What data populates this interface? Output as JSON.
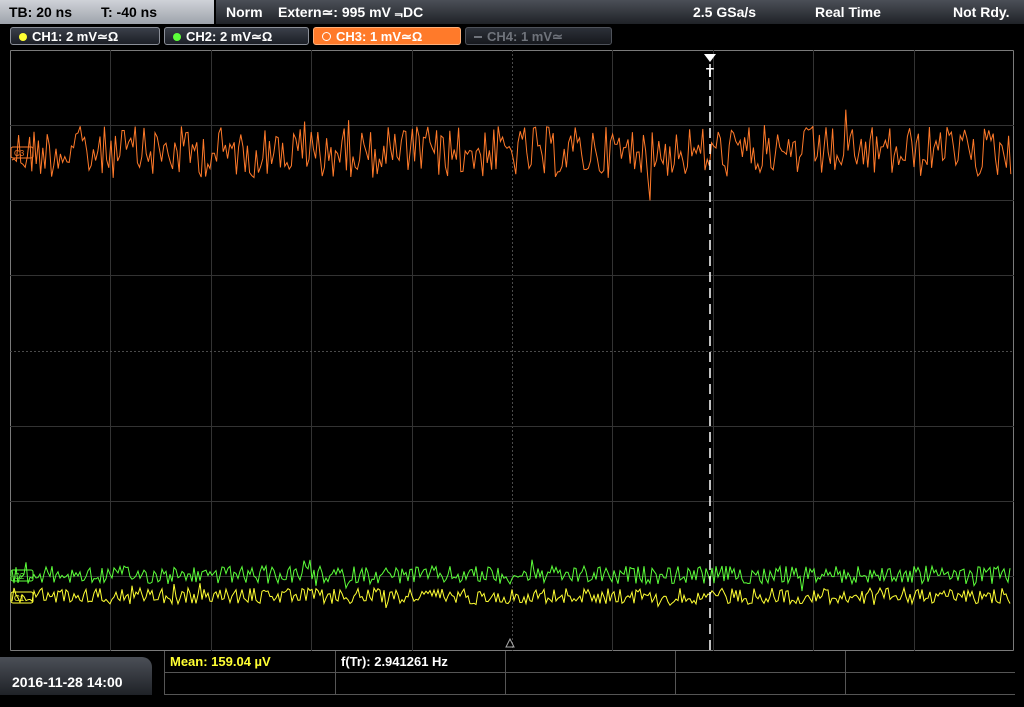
{
  "topbar": {
    "timebase": "TB: 20 ns",
    "trigger_time": "T: -40 ns",
    "acq_mode": "Norm",
    "trigger_source": "Extern≃: 995 mV ⫬DC",
    "sample_rate": "2.5 GSa/s",
    "timing_mode": "Real Time",
    "status": "Not Rdy."
  },
  "channels": [
    {
      "label": "CH1: 2 mV≃Ω",
      "color": "#ffff33",
      "state": "on"
    },
    {
      "label": "CH2: 2 mV≃Ω",
      "color": "#5cff3a",
      "state": "on"
    },
    {
      "label": "CH3: 1 mV≃Ω",
      "color": "#ff7a2a",
      "state": "active"
    },
    {
      "label": "CH4: 1 mV≃",
      "color": "#6f737b",
      "state": "off"
    }
  ],
  "screen": {
    "trigger_marker": "T",
    "ch_markers": {
      "ch1": "C1",
      "ch2": "C2",
      "ch3": "C3"
    }
  },
  "footer": {
    "datetime": "2016-11-28 14:00",
    "mean": "Mean: 159.04 µV",
    "frequency": "f(Tr): 2.941261 Hz"
  }
}
